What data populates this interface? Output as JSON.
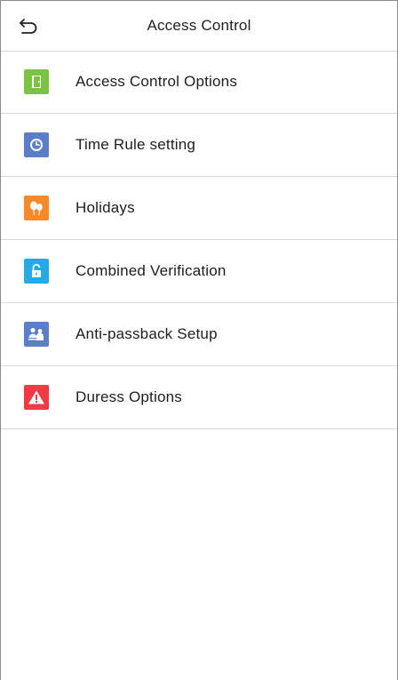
{
  "header": {
    "title": "Access Control",
    "back_icon": "back-arrow-icon"
  },
  "menu": {
    "items": [
      {
        "label": "Access Control Options",
        "icon": "door-icon",
        "color": "#7cc243"
      },
      {
        "label": "Time Rule setting",
        "icon": "clock-icon",
        "color": "#5b7ec8"
      },
      {
        "label": "Holidays",
        "icon": "balloons-icon",
        "color": "#f58a2c"
      },
      {
        "label": "Combined Verification",
        "icon": "unlock-icon",
        "color": "#27a9e6"
      },
      {
        "label": "Anti-passback Setup",
        "icon": "people-icon",
        "color": "#5b7ec8"
      },
      {
        "label": "Duress Options",
        "icon": "warning-icon",
        "color": "#ee3b44"
      }
    ]
  }
}
